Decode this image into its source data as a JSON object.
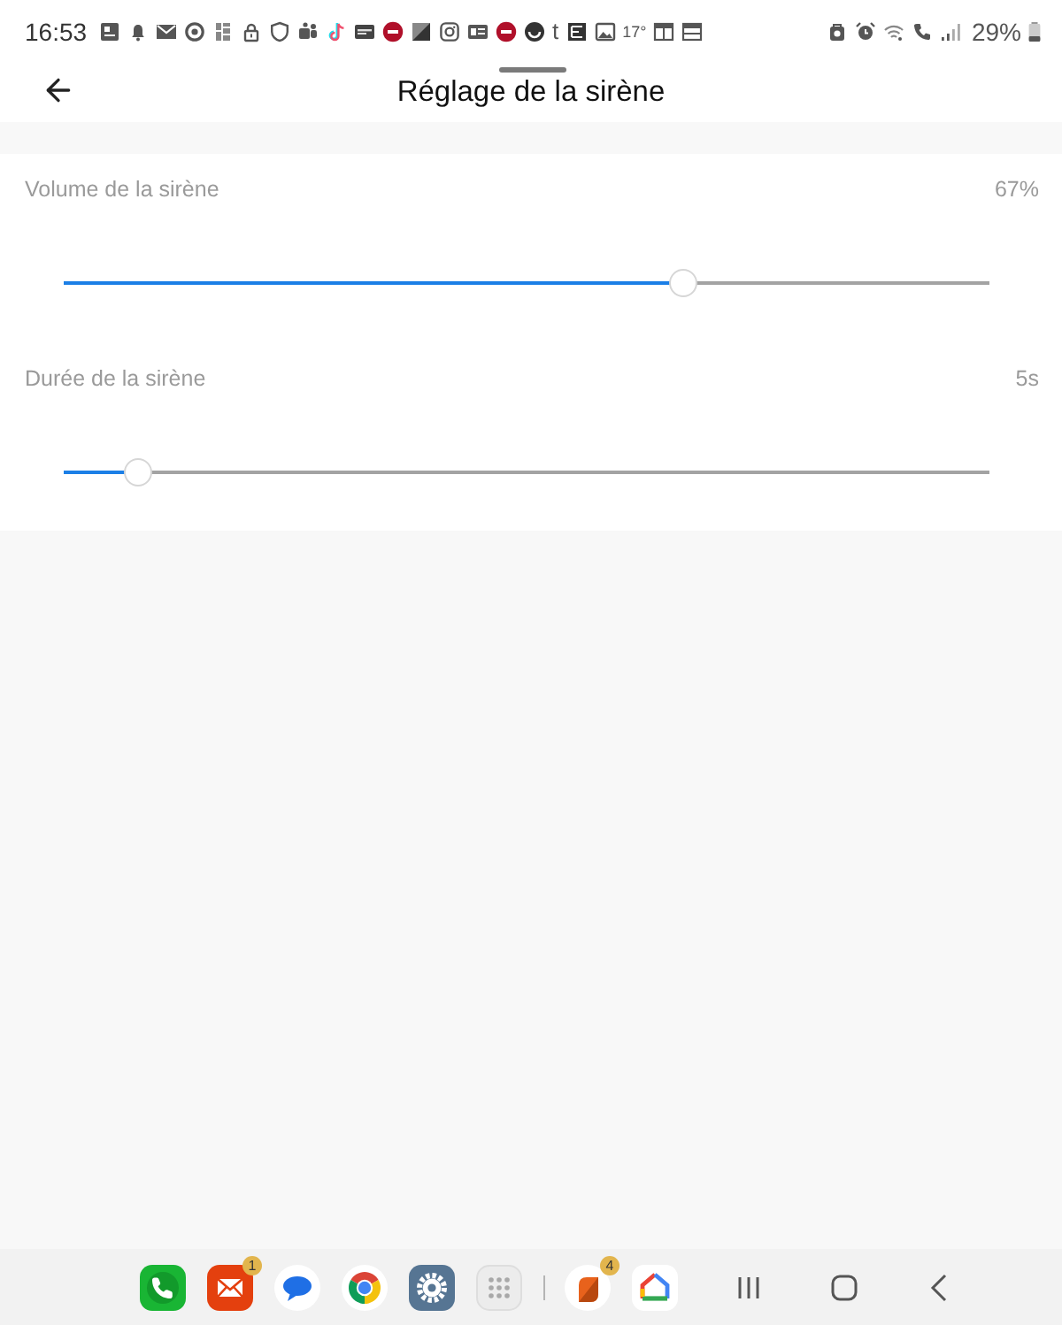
{
  "status_bar": {
    "time": "16:53",
    "letter": "t",
    "temperature": "17°",
    "battery": "29%"
  },
  "header": {
    "title": "Réglage de la sirène"
  },
  "settings": [
    {
      "label": "Volume de la sirène",
      "value": "67%",
      "level": 0.67
    },
    {
      "label": "Durée de la sirène",
      "value": "5s",
      "level": 0.08
    }
  ],
  "dock": {
    "apps": [
      {
        "kind": "phone"
      },
      {
        "kind": "mail",
        "badge": "1"
      },
      {
        "kind": "messages"
      },
      {
        "kind": "browser"
      },
      {
        "kind": "settings"
      },
      {
        "kind": "app_grid"
      }
    ],
    "recent_apps": [
      {
        "kind": "leaf",
        "badge": "4"
      },
      {
        "kind": "home"
      }
    ]
  }
}
